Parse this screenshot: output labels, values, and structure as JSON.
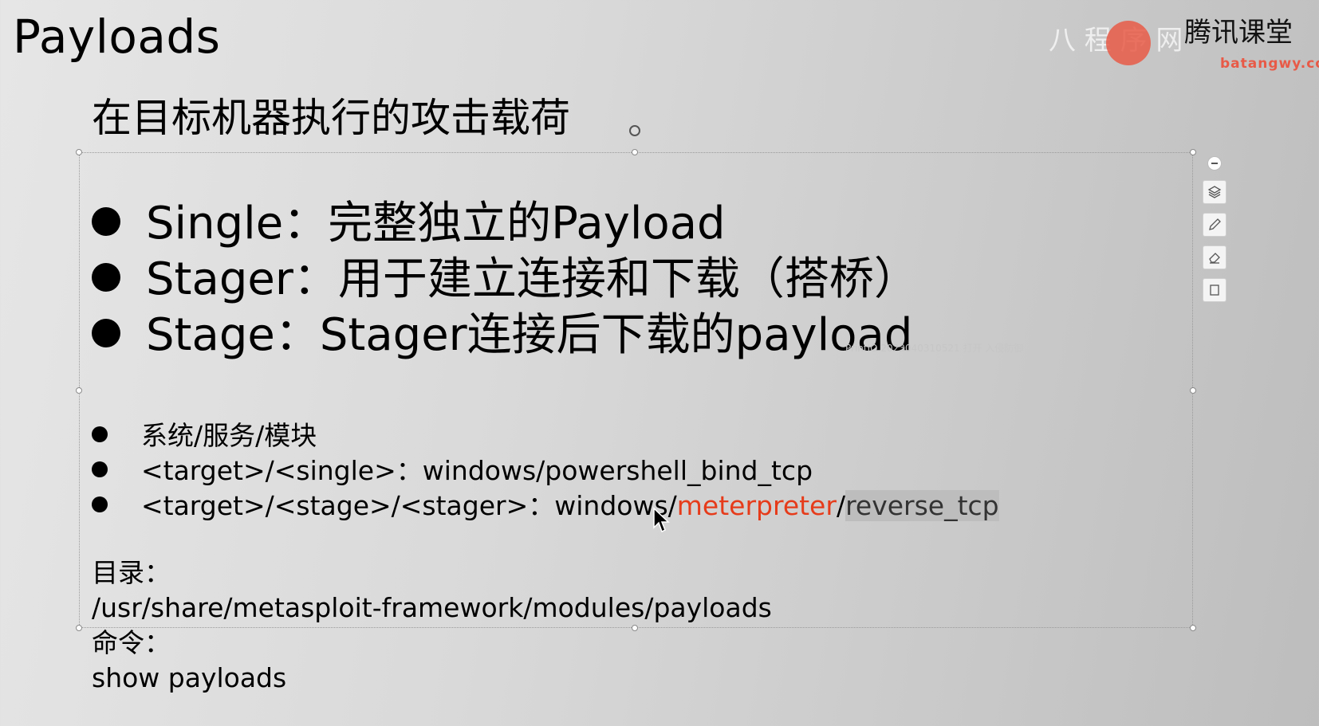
{
  "title": "Payloads",
  "subtitle": "在目标机器执行的攻击载荷",
  "bullets_large": [
    {
      "label": "Single",
      "sep": "：",
      "desc": "完整独立的Payload"
    },
    {
      "label": "Stager",
      "sep": "：",
      "desc": "用于建立连接和下载（搭桥）"
    },
    {
      "label": "Stage",
      "sep": "：",
      "desc": "Stager连接后下载的payload"
    }
  ],
  "bullets_small": {
    "item1": "系统/服务/模块",
    "item2": "<target>/<single>：windows/powershell_bind_tcp",
    "item3_prefix": "<target>/<stage>/<stager>：windows/",
    "item3_red": "meterpreter",
    "item3_slash": "/",
    "item3_selected": "reverse_tcp"
  },
  "directory": {
    "label": "目录：",
    "path": "/usr/share/metasploit-framework/modules/payloads"
  },
  "command": {
    "label": "命令：",
    "value": "show payloads"
  },
  "watermark_mid": "PrintIO 2023040310521 打开 入侵防御",
  "logo_text": "batangwy.com",
  "colors": {
    "accent_red": "#e63b1a",
    "selection": "#bdbdbd"
  },
  "icons": [
    "minus-icon",
    "layers-icon",
    "pen-icon",
    "eraser-icon",
    "square-icon"
  ]
}
